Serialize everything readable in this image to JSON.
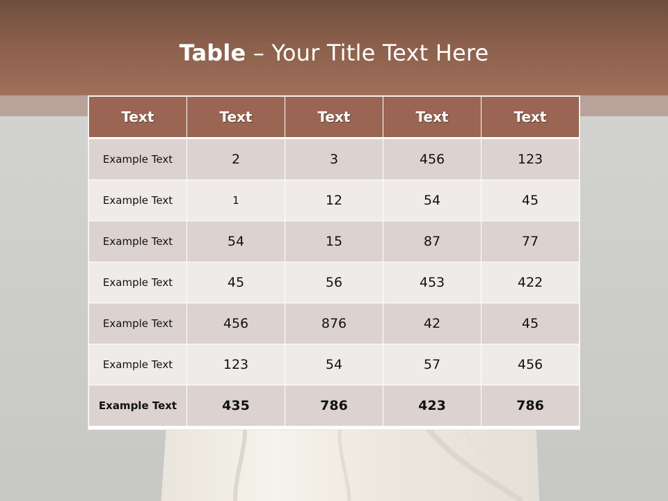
{
  "slide": {
    "title_bold": "Table",
    "title_rest": " – Your Title Text Here"
  },
  "table": {
    "headers": [
      "Text",
      "Text",
      "Text",
      "Text",
      "Text"
    ],
    "rows": [
      [
        "Example Text",
        "2",
        "3",
        "456",
        "123"
      ],
      [
        "Example Text",
        "1",
        "12",
        "54",
        "45"
      ],
      [
        "Example Text",
        "54",
        "15",
        "87",
        "77"
      ],
      [
        "Example Text",
        "45",
        "56",
        "453",
        "422"
      ],
      [
        "Example Text",
        "456",
        "876",
        "42",
        "45"
      ],
      [
        "Example Text",
        "123",
        "54",
        "57",
        "456"
      ],
      [
        "Example Text",
        "435",
        "786",
        "423",
        "786"
      ]
    ]
  },
  "colors": {
    "title_band": "#8a5f4b",
    "header_fill": "#9a6653",
    "row_odd": "#dcd3d1",
    "row_even": "#efebe8"
  }
}
